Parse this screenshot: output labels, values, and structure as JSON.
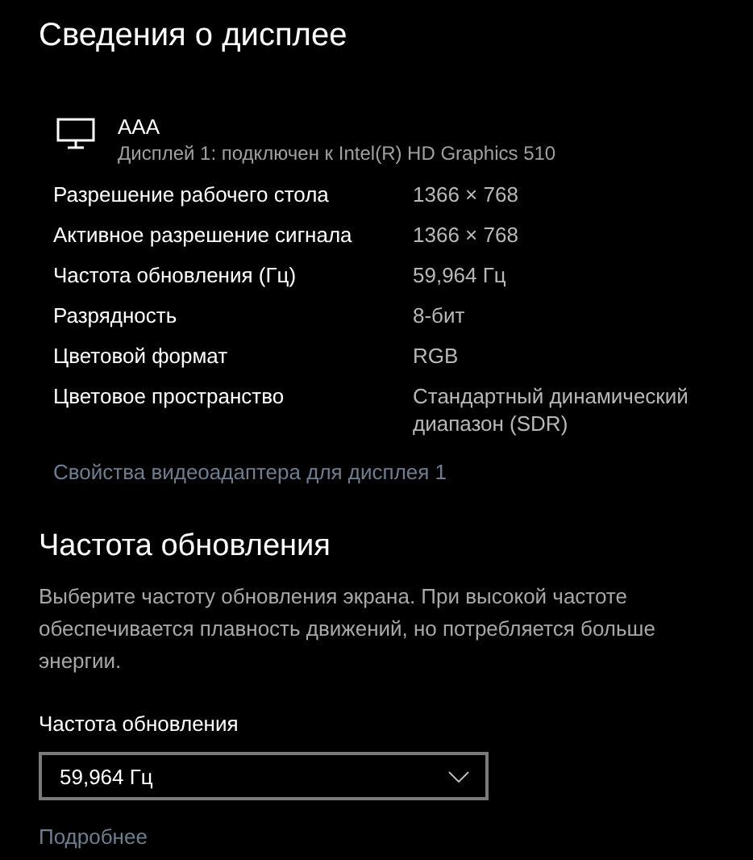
{
  "title": "Сведения о дисплее",
  "display": {
    "name": "AAA",
    "description": "Дисплей 1: подключен к Intel(R) HD Graphics 510"
  },
  "properties": [
    {
      "label": "Разрешение рабочего стола",
      "value": "1366 × 768"
    },
    {
      "label": "Активное разрешение сигнала",
      "value": "1366 × 768"
    },
    {
      "label": "Частота обновления (Гц)",
      "value": "59,964 Гц"
    },
    {
      "label": "Разрядность",
      "value": "8-бит"
    },
    {
      "label": "Цветовой формат",
      "value": "RGB"
    },
    {
      "label": "Цветовое пространство",
      "value": "Стандартный динамический диапазон (SDR)"
    }
  ],
  "adapter_link": "Свойства видеоадаптера для дисплея 1",
  "refresh_section": {
    "heading": "Частота обновления",
    "description": "Выберите частоту обновления экрана. При высокой частоте обеспечивается плавность движений, но потребляется больше энергии.",
    "field_label": "Частота обновления",
    "dropdown_value": "59,964 Гц",
    "more_link": "Подробнее"
  }
}
